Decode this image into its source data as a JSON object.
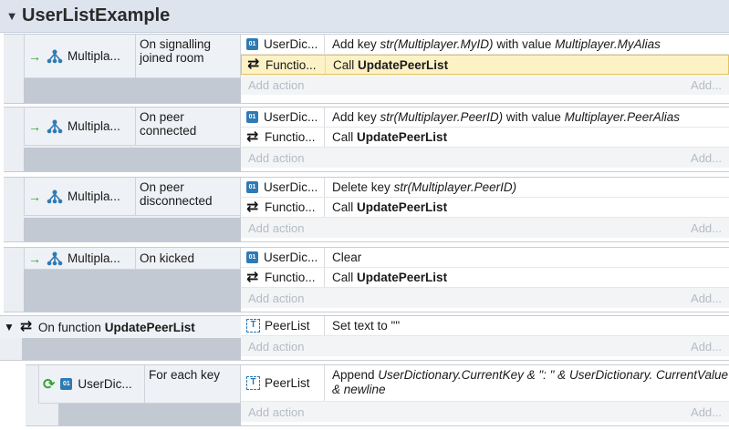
{
  "group": {
    "title": "UserListExample"
  },
  "events": [
    {
      "object": "Multipla...",
      "condition": "On signalling joined room",
      "actions": [
        {
          "object": "UserDic...",
          "icon": "dictionary-icon",
          "desc": [
            "Add key ",
            "str(Multiplayer.MyID)",
            " with value ",
            "Multiplayer.MyAlias"
          ]
        },
        {
          "object": "Functio...",
          "icon": "function-icon",
          "desc": [
            "Call ",
            "UpdatePeerList"
          ]
        }
      ]
    },
    {
      "object": "Multipla...",
      "condition": "On peer connected",
      "actions": [
        {
          "object": "UserDic...",
          "icon": "dictionary-icon",
          "desc": [
            "Add key ",
            "str(Multiplayer.PeerID)",
            " with value ",
            "Multiplayer.PeerAlias"
          ]
        },
        {
          "object": "Functio...",
          "icon": "function-icon",
          "desc": [
            "Call ",
            "UpdatePeerList"
          ]
        }
      ]
    },
    {
      "object": "Multipla...",
      "condition": "On peer disconnected",
      "actions": [
        {
          "object": "UserDic...",
          "icon": "dictionary-icon",
          "desc": [
            "Delete key ",
            "str(Multiplayer.PeerID)"
          ]
        },
        {
          "object": "Functio...",
          "icon": "function-icon",
          "desc": [
            "Call ",
            "UpdatePeerList"
          ]
        }
      ]
    },
    {
      "object": "Multipla...",
      "condition": "On kicked",
      "actions": [
        {
          "object": "UserDic...",
          "icon": "dictionary-icon",
          "desc": [
            "Clear"
          ]
        },
        {
          "object": "Functio...",
          "icon": "function-icon",
          "desc": [
            "Call ",
            "UpdatePeerList"
          ]
        }
      ]
    }
  ],
  "function_event": {
    "label_prefix": "On function ",
    "label_name": "UpdatePeerList",
    "action": {
      "object": "PeerList",
      "desc": "Set text to \"\""
    }
  },
  "sub_event": {
    "object": "UserDic...",
    "condition": "For each key",
    "action": {
      "object": "PeerList",
      "desc": [
        "Append ",
        "UserDictionary.CurrentKey & \": \" & UserDictionary.",
        " ",
        "CurrentValue & newline"
      ]
    }
  },
  "add_action": "Add action",
  "add_more": "Add..."
}
